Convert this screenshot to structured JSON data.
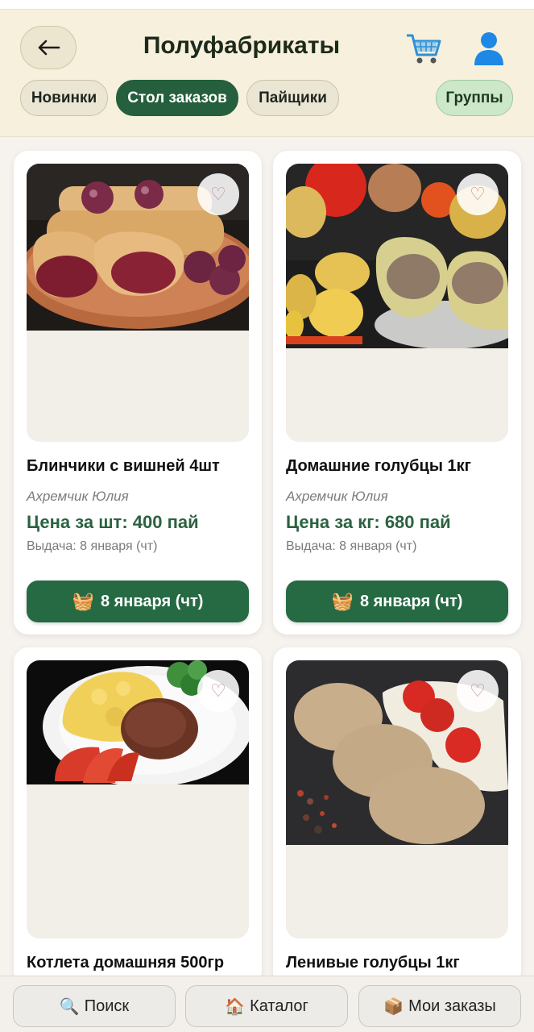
{
  "header": {
    "title": "Полуфабрикаты",
    "back_icon": "arrow-left-icon",
    "cart_icon": "shopping-cart-icon",
    "user_icon": "user-icon"
  },
  "filters": [
    {
      "label": "Новинки",
      "active": false
    },
    {
      "label": "Стол заказов",
      "active": true
    },
    {
      "label": "Пайщики",
      "active": false
    },
    {
      "label": "Группы",
      "active": false
    }
  ],
  "products": [
    {
      "name": "Блинчики с вишней 4шт",
      "seller": "Ахремчик Юлия",
      "price": "Цена за шт: 400 пай",
      "issue": "Выдача: 8 января (чт)",
      "order_label": "8 января (чт)",
      "image": "pancakes-with-cherries"
    },
    {
      "name": "Домашние голубцы 1кг",
      "seller": "Ахремчик Юлия",
      "price": "Цена за кг: 680 пай",
      "issue": "Выдача: 8 января (чт)",
      "order_label": "8 января (чт)",
      "image": "cabbage-rolls-with-potatoes"
    },
    {
      "name": "Котлета домашняя 500гр",
      "image": "cutlet-with-mashed-potatoes"
    },
    {
      "name": "Ленивые голубцы 1кг",
      "image": "lazy-cabbage-rolls"
    }
  ],
  "bottom_nav": [
    {
      "label": "Поиск",
      "icon": "🔍"
    },
    {
      "label": "Каталог",
      "icon": "🏠"
    },
    {
      "label": "Мои заказы",
      "icon": "📦"
    }
  ],
  "colors": {
    "header_bg": "#f7f0dc",
    "accent": "#266a43",
    "price": "#2b6241",
    "groups_chip": "#cde8c8"
  }
}
